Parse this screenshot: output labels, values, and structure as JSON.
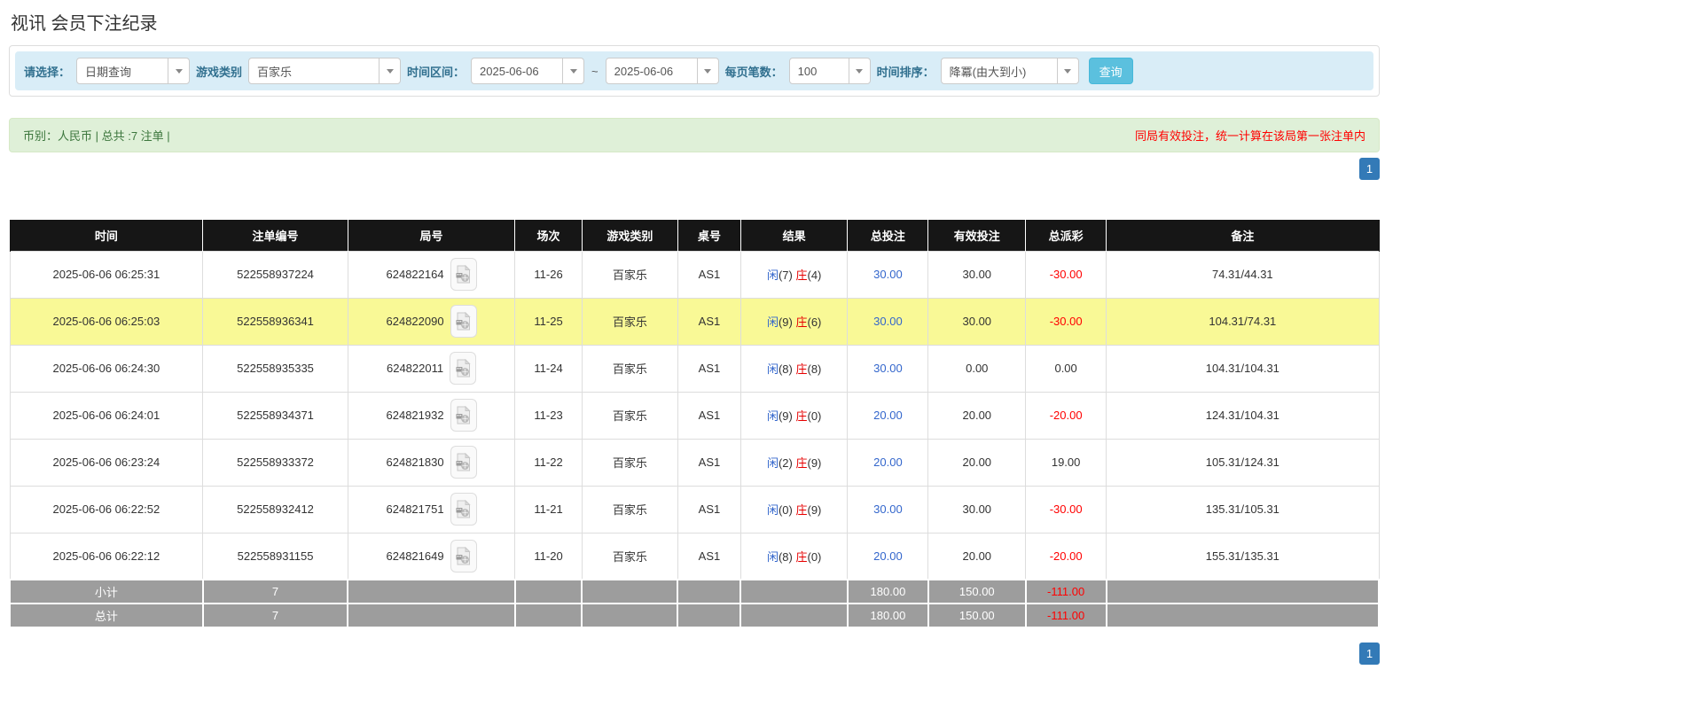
{
  "page": {
    "title": "视讯 会员下注纪录"
  },
  "filters": {
    "select_label": "请选择：",
    "select_value": "日期查询",
    "game_type_label": "游戏类别",
    "game_type_value": "百家乐",
    "date_range_label": "时间区间：",
    "date_from": "2025-06-06",
    "date_separator": "~",
    "date_to": "2025-06-06",
    "page_size_label": "每页笔数：",
    "page_size_value": "100",
    "sort_label": "时间排序：",
    "sort_value": "降冪(由大到小)",
    "search_button": "查询"
  },
  "summary": {
    "left_text": "币别：人民币 | 总共 :7 注单 |",
    "right_note": "同局有效投注，统一计算在该局第一张注单内"
  },
  "pagination": {
    "page": "1"
  },
  "colors": {
    "accent_blue": "#337ab7",
    "link_blue": "#3366cc",
    "banker_red": "#e60000",
    "negative_red": "#ff0000",
    "highlight_yellow": "#f9f996",
    "header_black": "#161616",
    "footer_gray": "#9d9d9d",
    "filter_bar_bg": "#d9edf7",
    "summary_bar_bg": "#dff0d8",
    "search_button_bg": "#5bc0de"
  },
  "table": {
    "headers": [
      "时间",
      "注单编号",
      "局号",
      "场次",
      "游戏类别",
      "桌号",
      "结果",
      "总投注",
      "有效投注",
      "总派彩",
      "备注"
    ],
    "rows": [
      {
        "time": "2025-06-06 06:25:31",
        "bet_id": "522558937224",
        "round_id": "624822164",
        "session": "11-26",
        "game": "百家乐",
        "table_no": "AS1",
        "player_label": "闲",
        "player_score": "(7)",
        "banker_label": "庄",
        "banker_score": "(4)",
        "total_bet": "30.00",
        "valid_bet": "30.00",
        "payout": "-30.00",
        "remark": "74.31/44.31",
        "highlight": false
      },
      {
        "time": "2025-06-06 06:25:03",
        "bet_id": "522558936341",
        "round_id": "624822090",
        "session": "11-25",
        "game": "百家乐",
        "table_no": "AS1",
        "player_label": "闲",
        "player_score": "(9)",
        "banker_label": "庄",
        "banker_score": "(6)",
        "total_bet": "30.00",
        "valid_bet": "30.00",
        "payout": "-30.00",
        "remark": "104.31/74.31",
        "highlight": true
      },
      {
        "time": "2025-06-06 06:24:30",
        "bet_id": "522558935335",
        "round_id": "624822011",
        "session": "11-24",
        "game": "百家乐",
        "table_no": "AS1",
        "player_label": "闲",
        "player_score": "(8)",
        "banker_label": "庄",
        "banker_score": "(8)",
        "total_bet": "30.00",
        "valid_bet": "0.00",
        "payout": "0.00",
        "remark": "104.31/104.31",
        "highlight": false
      },
      {
        "time": "2025-06-06 06:24:01",
        "bet_id": "522558934371",
        "round_id": "624821932",
        "session": "11-23",
        "game": "百家乐",
        "table_no": "AS1",
        "player_label": "闲",
        "player_score": "(9)",
        "banker_label": "庄",
        "banker_score": "(0)",
        "total_bet": "20.00",
        "valid_bet": "20.00",
        "payout": "-20.00",
        "remark": "124.31/104.31",
        "highlight": false
      },
      {
        "time": "2025-06-06 06:23:24",
        "bet_id": "522558933372",
        "round_id": "624821830",
        "session": "11-22",
        "game": "百家乐",
        "table_no": "AS1",
        "player_label": "闲",
        "player_score": "(2)",
        "banker_label": "庄",
        "banker_score": "(9)",
        "total_bet": "20.00",
        "valid_bet": "20.00",
        "payout": "19.00",
        "remark": "105.31/124.31",
        "highlight": false
      },
      {
        "time": "2025-06-06 06:22:52",
        "bet_id": "522558932412",
        "round_id": "624821751",
        "session": "11-21",
        "game": "百家乐",
        "table_no": "AS1",
        "player_label": "闲",
        "player_score": "(0)",
        "banker_label": "庄",
        "banker_score": "(9)",
        "total_bet": "30.00",
        "valid_bet": "30.00",
        "payout": "-30.00",
        "remark": "135.31/105.31",
        "highlight": false
      },
      {
        "time": "2025-06-06 06:22:12",
        "bet_id": "522558931155",
        "round_id": "624821649",
        "session": "11-20",
        "game": "百家乐",
        "table_no": "AS1",
        "player_label": "闲",
        "player_score": "(8)",
        "banker_label": "庄",
        "banker_score": "(0)",
        "total_bet": "20.00",
        "valid_bet": "20.00",
        "payout": "-20.00",
        "remark": "155.31/135.31",
        "highlight": false
      }
    ],
    "totals": {
      "subtotal": {
        "label": "小计",
        "count": "7",
        "total_bet": "180.00",
        "valid_bet": "150.00",
        "payout": "-111.00"
      },
      "grand": {
        "label": "总计",
        "count": "7",
        "total_bet": "180.00",
        "valid_bet": "150.00",
        "payout": "-111.00"
      }
    }
  }
}
